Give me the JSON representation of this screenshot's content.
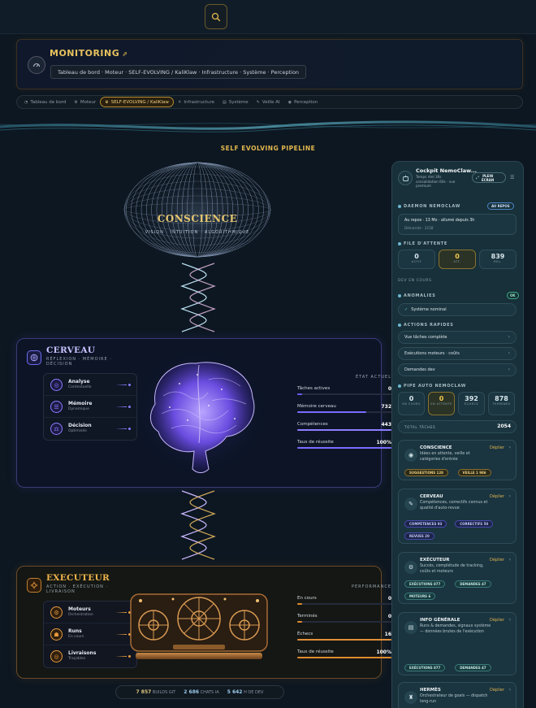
{
  "header": {
    "title": "MONITORING",
    "pin": "⇗",
    "subtitle": "Tableau de bord · Moteur · SELF-EVOLVING / KaliKlaw · Infrastructure · Système · Perception"
  },
  "nav": {
    "tabs": [
      {
        "label": "Tableau de bord",
        "icon": "dashboard-icon",
        "glyph": "◔",
        "active": false
      },
      {
        "label": "Moteur",
        "icon": "engine-icon",
        "glyph": "⚙",
        "active": false
      },
      {
        "label": "SELF-EVOLVING / KaliKlaw",
        "icon": "evolve-icon",
        "glyph": "♛",
        "active": true
      },
      {
        "label": "Infrastructure",
        "icon": "network-icon",
        "glyph": "⚘",
        "active": false
      },
      {
        "label": "Système",
        "icon": "server-icon",
        "glyph": "▤",
        "active": false
      },
      {
        "label": "Veille AI",
        "icon": "radar-icon",
        "glyph": "✎",
        "active": false
      },
      {
        "label": "Perception",
        "icon": "eye-icon",
        "glyph": "◉",
        "active": false
      }
    ]
  },
  "pipeline": {
    "title": "SELF EVOLVING PIPELINE",
    "conscience": {
      "title": "CONSCIENCE",
      "subtitle": "VISION · INTUITION · ALGORITHMIQUE"
    },
    "cerveau": {
      "title": "CERVEAU",
      "subtitle_line1": "RÉFLEXION · MÉMOIRE ·",
      "subtitle_line2": "DÉCISION",
      "features": [
        {
          "name": "Analyse",
          "sub": "Contextuelle",
          "glyph": "◎"
        },
        {
          "name": "Mémoire",
          "sub": "Dynamique",
          "glyph": "☰"
        },
        {
          "name": "Décision",
          "sub": "Optimisée",
          "glyph": "⚖"
        }
      ],
      "stats_header": "ÉTAT ACTUEL",
      "stats": [
        {
          "label": "Tâches actives",
          "value": "0",
          "fill": 0.05,
          "color": "#6a5cff"
        },
        {
          "label": "Mémoire cerveau",
          "value": "732",
          "fill": 0.73,
          "color": "#7b6bff"
        },
        {
          "label": "Compétences",
          "value": "443",
          "fill": 1.0,
          "color": "#8d7dff"
        },
        {
          "label": "Taux de réussite",
          "value": "100%",
          "fill": 1.0,
          "color": "#7b6bff"
        }
      ]
    },
    "executeur": {
      "title": "EXECUTEUR",
      "subtitle_line1": "ACTION · EXÉCUTION ·",
      "subtitle_line2": "LIVRAISON",
      "features": [
        {
          "name": "Moteurs",
          "sub": "Orchestration",
          "glyph": "⚙"
        },
        {
          "name": "Runs",
          "sub": "En cours",
          "glyph": "☗"
        },
        {
          "name": "Livraisons",
          "sub": "Traçables",
          "glyph": "◎"
        }
      ],
      "stats_header": "PERFORMANCE",
      "stats": [
        {
          "label": "En cours",
          "value": "0",
          "fill": 0.05,
          "color": "#e08a2e"
        },
        {
          "label": "Terminés",
          "value": "0",
          "fill": 0.05,
          "color": "#e08a2e"
        },
        {
          "label": "Échecs",
          "value": "16",
          "fill": 1.0,
          "color": "#e0903a"
        },
        {
          "label": "Taux de réussite",
          "value": "100%",
          "fill": 1.0,
          "color": "#e08a2e"
        }
      ]
    },
    "footer": [
      {
        "value": "7 857",
        "label": "BUILDS GIT",
        "cls": ""
      },
      {
        "value": "2 686",
        "label": "CHATS IA",
        "cls": "c"
      },
      {
        "value": "5 642",
        "label": "H DE DEV",
        "cls": "c"
      }
    ]
  },
  "side": {
    "title": "Cockpit NemoClaw...",
    "desc_line1": "Temps réel 30s",
    "desc_line2": "consolidation 60s · vue",
    "desc_line3": "premium",
    "fullscreen_line1": "PLEIN",
    "fullscreen_line2": "ÉCRAN",
    "daemon": {
      "label": "DAEMON NEMOCLAW",
      "badge": "AU REPOS",
      "status": "Au repos · 13 Mo · allumé depuis 3h",
      "sub": "Démarrée · 2158"
    },
    "queue": {
      "label": "FILE D'ATTENTE",
      "items": [
        {
          "n": "0",
          "l": "ACTIF",
          "color": "#d8e6ec"
        },
        {
          "n": "0",
          "l": "ATT.",
          "color": "#f0c64e"
        },
        {
          "n": "839",
          "l": "REL.",
          "color": "#d8e6ec"
        }
      ]
    },
    "dev_en_cours": "DEV EN COURS",
    "anomalies": {
      "label": "ANOMALIES",
      "badge": "OK",
      "status": "Système nominal"
    },
    "quick": {
      "label": "ACTIONS RAPIDES",
      "items": [
        "Vue tâches complète",
        "Exécutions moteurs · coûts",
        "Demandes dev"
      ]
    },
    "pipe": {
      "label": "PIPE AUTO NEMOCLAW",
      "items": [
        {
          "n": "0",
          "l": "EN COURS",
          "color": "#d8e6ec"
        },
        {
          "n": "0",
          "l": "EN ATTENTE",
          "color": "#f0c64e"
        },
        {
          "n": "392",
          "l": "ÉCHECS",
          "color": "#d8e6ec"
        },
        {
          "n": "878",
          "l": "TERMINÉS",
          "color": "#d8e6ec"
        }
      ],
      "total_label": "TOTAL TÂCHES",
      "total": "2054"
    },
    "cards": [
      {
        "title": "CONSCIENCE",
        "desc": "Idées en attente, veille et catégories d'entrée",
        "link": "Déplier",
        "glyph": "◉",
        "chips": [
          {
            "t": "SUGGESTIONS 128",
            "c": "gold"
          },
          {
            "t": "VEILLE 1 986",
            "c": "gold"
          }
        ]
      },
      {
        "title": "CERVEAU",
        "desc": "Compétences, correctifs connus et qualité d'auto-revue",
        "link": "Déplier",
        "glyph": "✎",
        "chips": [
          {
            "t": "COMPÉTENCES 93",
            "c": "blue"
          },
          {
            "t": "CORRECTIFS 50",
            "c": "blue"
          },
          {
            "t": "REVUES 20",
            "c": "blue"
          }
        ]
      },
      {
        "title": "EXÉCUTEUR",
        "desc": "Succès, complétude de tracking, coûts et moteurs",
        "link": "Déplier",
        "glyph": "⚙",
        "chips": [
          {
            "t": "EXÉCUTIONS 877",
            "c": "teal"
          },
          {
            "t": "DEMANDES 47",
            "c": "teal"
          },
          {
            "t": "MOTEURS 6",
            "c": "teal"
          }
        ]
      },
      {
        "title": "INFO GÉNÉRALE",
        "desc": "Runs & demandes, signaux système — données brutes de l'exécution",
        "link": "Déplier",
        "glyph": "▤",
        "chips": [
          {
            "t": "EXÉCUTIONS 877",
            "c": "teal"
          },
          {
            "t": "DEMANDES 47",
            "c": "teal"
          }
        ]
      },
      {
        "title": "HERMÈS",
        "desc": "Orchestrateur de goals — dispatch long-run",
        "link": "Déplier",
        "glyph": "♜",
        "chips": []
      }
    ]
  }
}
